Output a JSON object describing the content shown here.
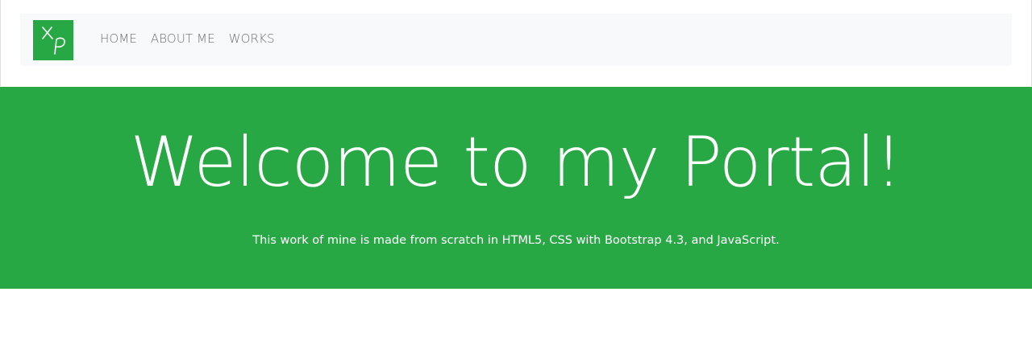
{
  "nav": {
    "brand": {
      "icon": "xp-logo-icon",
      "background": "#28a745"
    },
    "items": [
      {
        "label": "HOME"
      },
      {
        "label": "ABOUT ME"
      },
      {
        "label": "WORKS"
      }
    ]
  },
  "hero": {
    "title": "Welcome to my Portal!",
    "subtitle": "This work of mine is made from scratch in HTML5, CSS with Bootstrap 4.3, and JavaScript.",
    "background": "#28a745",
    "text_color": "#ffffff"
  },
  "colors": {
    "navbar_bg": "#f8f9fa",
    "nav_link": "#6b6f73",
    "accent": "#28a745"
  }
}
